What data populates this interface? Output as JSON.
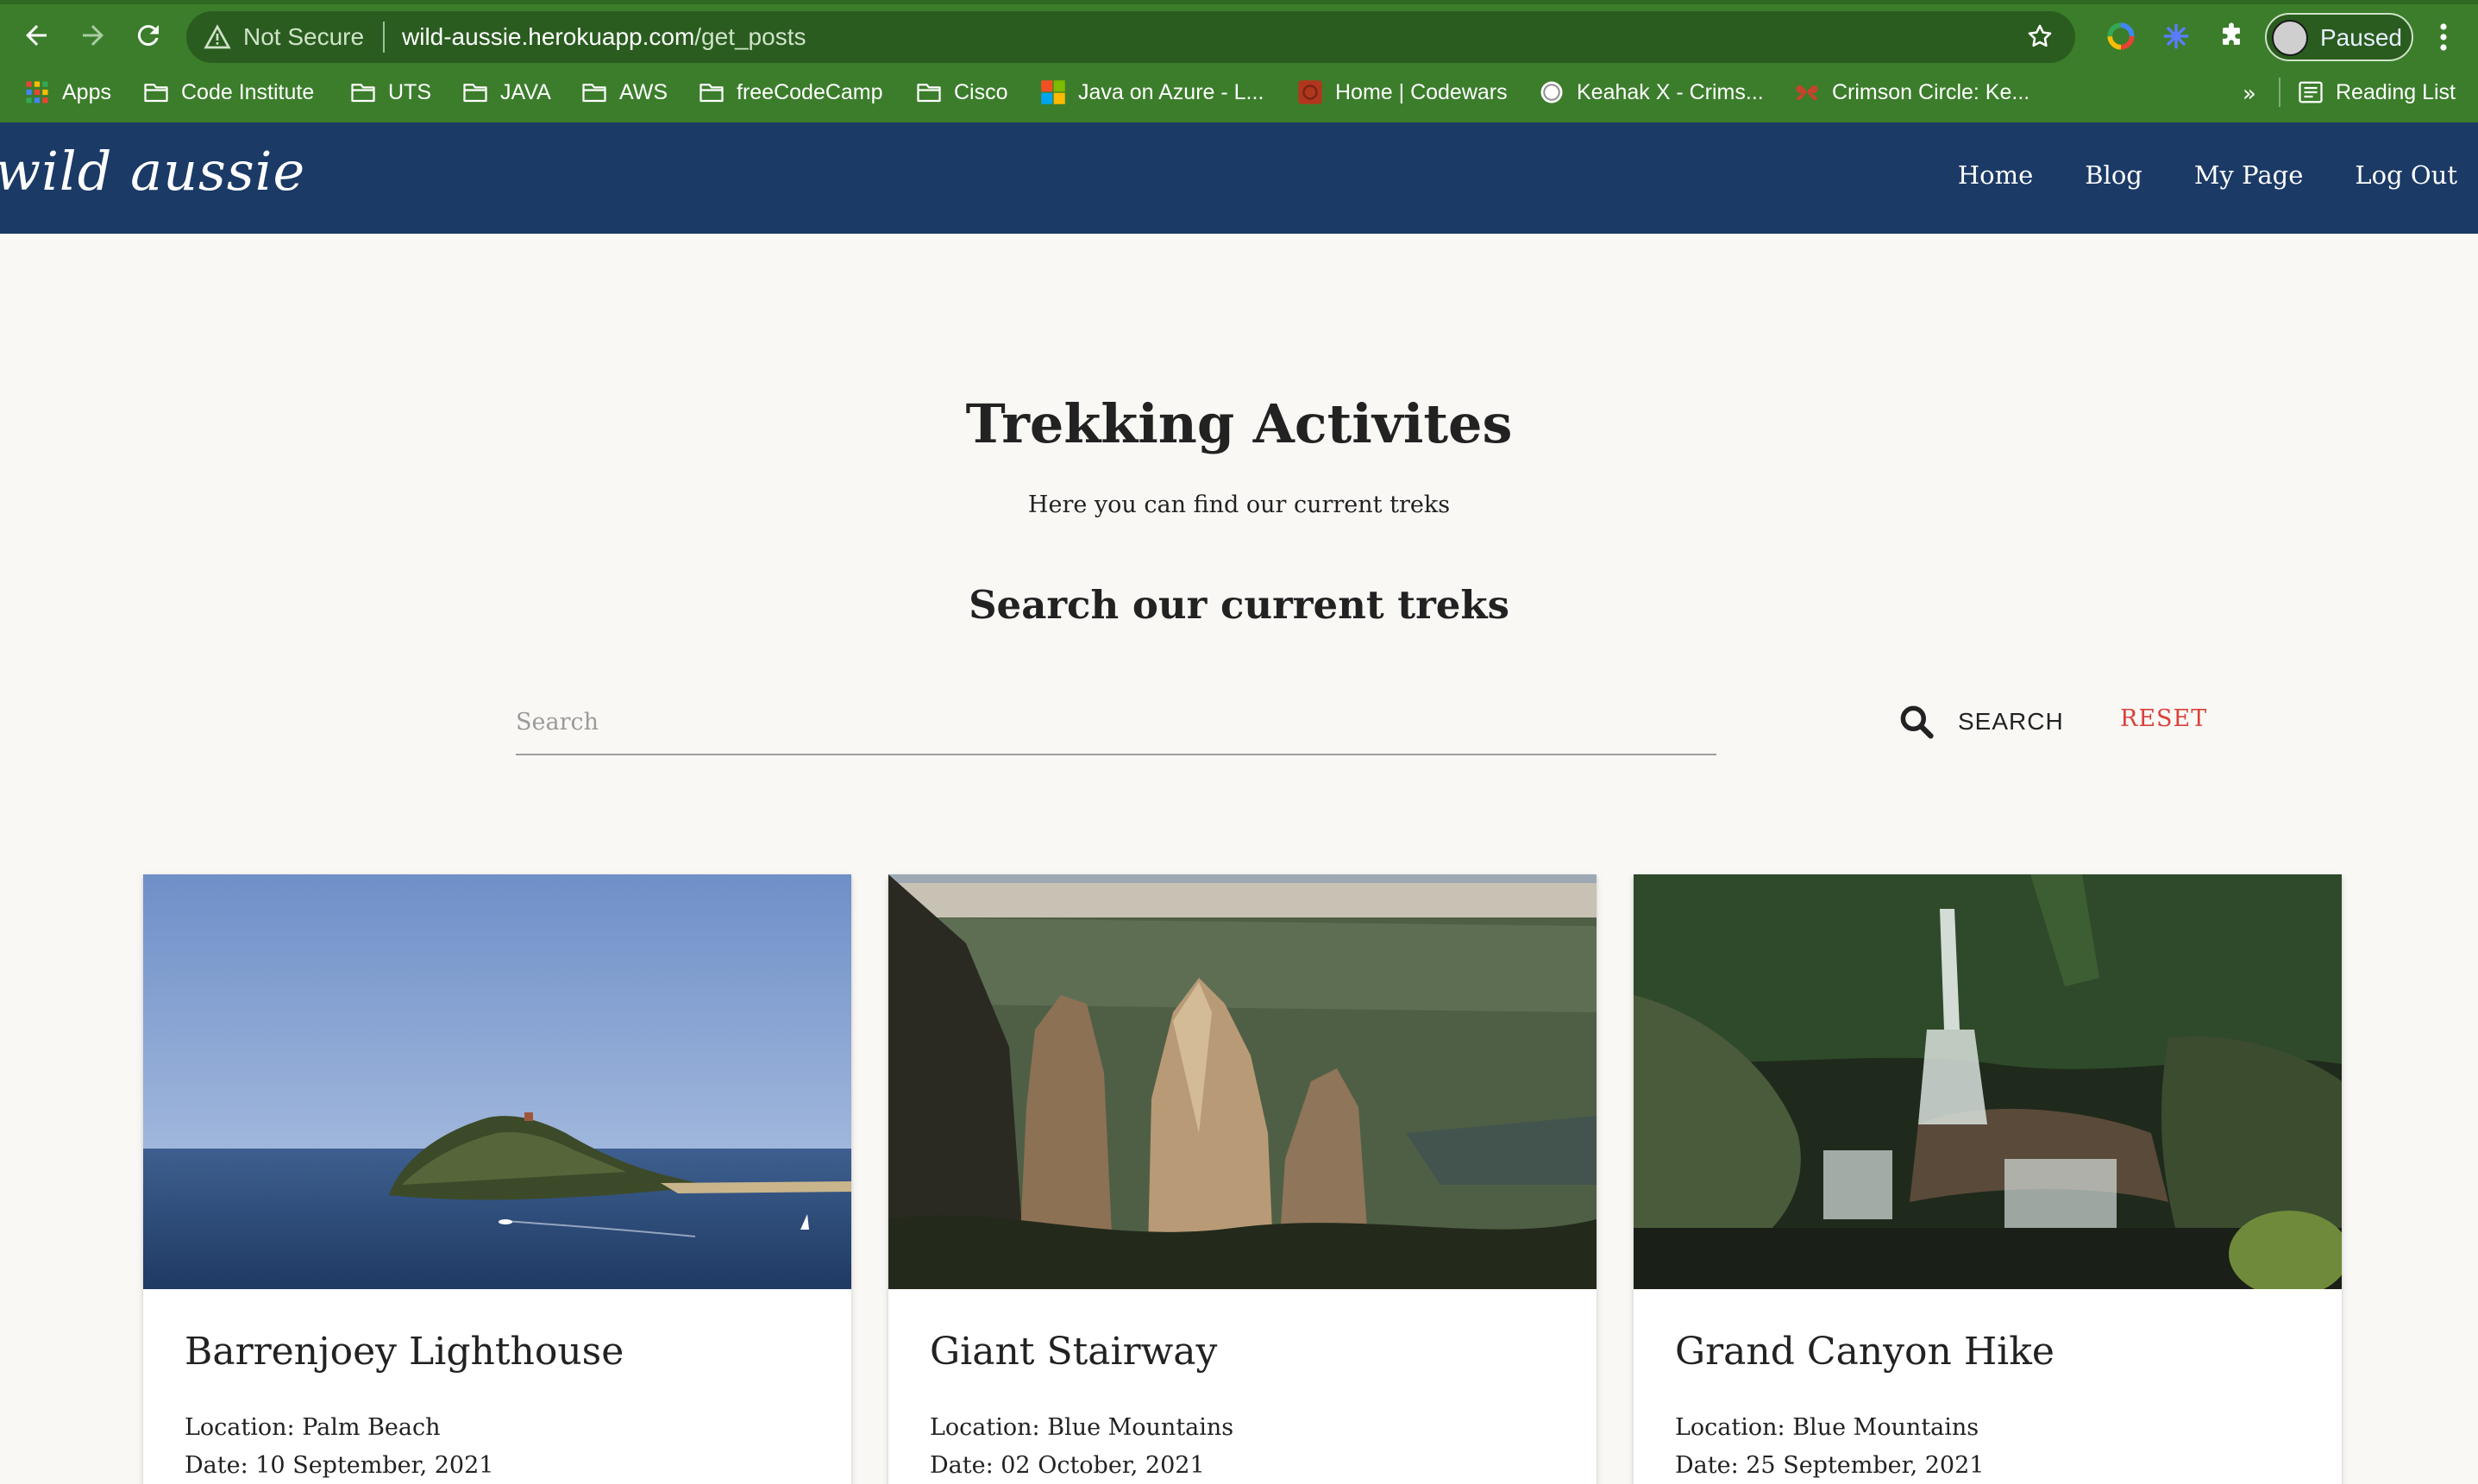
{
  "browser": {
    "security_label": "Not Secure",
    "url_host": "wild-aussie.herokuapp.com",
    "url_path": "/get_posts",
    "profile_label": "Paused",
    "bookmarks": [
      "Apps",
      "Code Institute",
      "UTS",
      "JAVA",
      "AWS",
      "freeCodeCamp",
      "Cisco",
      "Java on Azure - L...",
      "Home | Codewars",
      "Keahak X - Crims...",
      "Crimson Circle: Ke..."
    ],
    "bookmarks_overflow": "»",
    "reading_list": "Reading List"
  },
  "site": {
    "brand": "wild aussie",
    "nav": [
      "Home",
      "Blog",
      "My Page",
      "Log Out"
    ]
  },
  "main": {
    "title": "Trekking Activites",
    "subtitle": "Here you can find our current treks",
    "search_heading": "Search our current treks",
    "search_placeholder": "Search",
    "search_button": "SEARCH",
    "reset_button": "RESET"
  },
  "cards": [
    {
      "title": "Barrenjoey Lighthouse",
      "location": "Location: Palm Beach",
      "date": "Date: 10 September, 2021"
    },
    {
      "title": "Giant Stairway",
      "location": "Location: Blue Mountains",
      "date": "Date: 02 October, 2021"
    },
    {
      "title": "Grand Canyon Hike",
      "location": "Location: Blue Mountains",
      "date": "Date: 25 September, 2021"
    }
  ],
  "colors": {
    "browser_frame": "#3b7d2b",
    "nav_background": "#1b3a66",
    "page_background": "#f9f8f5",
    "reset_accent": "#d9413a"
  }
}
